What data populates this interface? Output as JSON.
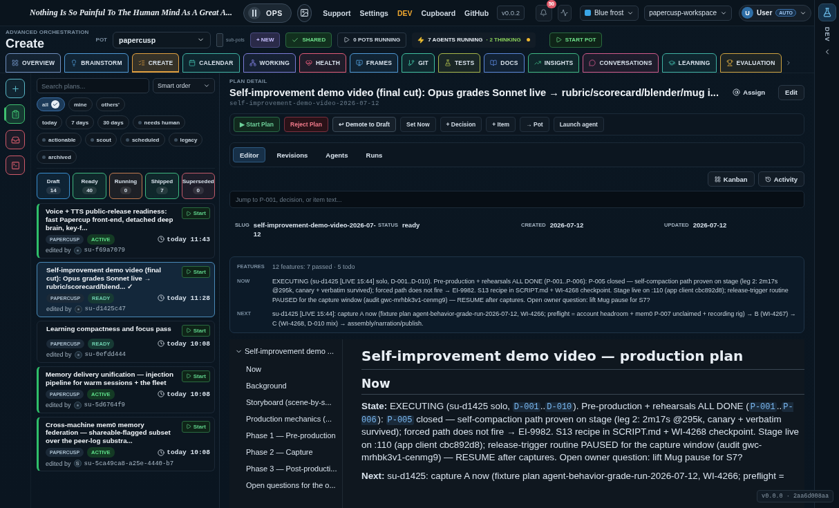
{
  "top_bar": {
    "quote": "Nothing Is So Painful To The Human Mind As A Great A...",
    "ops_label": "OPS",
    "nav": [
      {
        "label": "Support",
        "selected": false
      },
      {
        "label": "Settings",
        "selected": false
      },
      {
        "label": "DEV",
        "selected": true
      },
      {
        "label": "Cupboard",
        "selected": false
      },
      {
        "label": "GitHub",
        "selected": false
      }
    ],
    "version": "v0.0.2",
    "notifications": "50",
    "theme": {
      "label": "Blue frost",
      "color": "#3aa6e8"
    },
    "workspace": "papercusp-workspace",
    "user": {
      "avatar": "U",
      "name": "User",
      "badge": "AUTO"
    }
  },
  "header": {
    "eyebrow": "ADVANCED ORCHESTRATION",
    "title": "Create",
    "pot_label": "POT",
    "pot": "papercusp",
    "subpots": {
      "label": "sub-pots",
      "checked": false
    },
    "buttons": [
      {
        "label": "+ NEW",
        "kind": "new"
      },
      {
        "label": "SHARED",
        "kind": "shared"
      },
      {
        "label": "0 POTS RUNNING",
        "kind": "running"
      }
    ],
    "agents": {
      "label": "7 AGENTS RUNNING",
      "thinking": "· 2 THINKING"
    },
    "start": "START POT"
  },
  "tabs": [
    {
      "label": "OVERVIEW",
      "selected": false,
      "color": "#6f90c0"
    },
    {
      "label": "BRAINSTORM",
      "selected": false,
      "color": "#4f9ad6"
    },
    {
      "label": "CREATE",
      "selected": true,
      "color": "#e0a040"
    },
    {
      "label": "CALENDAR",
      "selected": false,
      "color": "#3fb2a4"
    },
    {
      "label": "WORKING",
      "selected": false,
      "color": "#7c7cd8"
    },
    {
      "label": "HEALTH",
      "selected": false,
      "color": "#e05a78"
    },
    {
      "label": "FRAMES",
      "selected": false,
      "color": "#4f9ad6"
    },
    {
      "label": "GIT",
      "selected": false,
      "color": "#3fc0a0"
    },
    {
      "label": "TESTS",
      "selected": false,
      "color": "#a8b84a"
    },
    {
      "label": "DOCS",
      "selected": false,
      "color": "#5a86d8"
    },
    {
      "label": "INSIGHTS",
      "selected": false,
      "color": "#3fb884"
    },
    {
      "label": "CONVERSATIONS",
      "selected": false,
      "color": "#d05a8c"
    },
    {
      "label": "LEARNING",
      "selected": false,
      "color": "#3fb2a4"
    },
    {
      "label": "EVALUATION",
      "selected": false,
      "color": "#d0a440"
    }
  ],
  "rail": [
    {
      "selected": false,
      "color": "#5ab8c8"
    },
    {
      "selected": true,
      "color": "#3fc070"
    },
    {
      "selected": false,
      "color": "#d05a6a"
    },
    {
      "selected": false,
      "color": "#d05a6a"
    }
  ],
  "plans": {
    "search_placeholder": "Search plans...",
    "order": "Smart order",
    "owner_filters": [
      {
        "label": "all",
        "selected": true
      },
      {
        "label": "mine",
        "selected": false
      },
      {
        "label": "others'",
        "selected": false
      }
    ],
    "filters": [
      {
        "label": "today",
        "kind": "plain"
      },
      {
        "label": "7 days",
        "kind": "plain"
      },
      {
        "label": "30 days",
        "kind": "plain"
      },
      {
        "label": "needs human",
        "kind": "dot"
      },
      {
        "label": "actionable",
        "kind": "dot"
      },
      {
        "label": "scout",
        "kind": "dot"
      },
      {
        "label": "scheduled",
        "kind": "dot"
      },
      {
        "label": "legacy",
        "kind": "dot"
      },
      {
        "label": "archived",
        "kind": "dot"
      }
    ],
    "counts": [
      {
        "label": "Draft",
        "count": "14",
        "color": "#3a8fd0"
      },
      {
        "label": "Ready",
        "count": "40",
        "color": "#3fb880"
      },
      {
        "label": "Running",
        "count": "0",
        "color": "#c07a50"
      },
      {
        "label": "Shipped",
        "count": "7",
        "color": "#3fb880"
      },
      {
        "label": "Superseded",
        "count": "0",
        "color": "#c05a6a"
      }
    ],
    "cards": [
      {
        "title": "Voice + TTS public-release readiness: fast Papercup front-end, detached deep brain, key-f...",
        "pot": "PAPERCUSP",
        "status": "ACTIVE",
        "kind": "active",
        "time": "today 11:43",
        "edited_by": "edited by",
        "editor": "su-f69a7079",
        "selected": false,
        "start": "Start"
      },
      {
        "title": "Self-improvement demo video (final cut): Opus grades Sonnet live → rubric/scorecard/blend... ✓",
        "pot": "PAPERCUSP",
        "status": "READY",
        "kind": "ready",
        "time": "today 11:28",
        "edited_by": "edited by",
        "editor": "su-d1425c47",
        "selected": true,
        "start": "Start"
      },
      {
        "title": "Learning compactness and focus pass",
        "pot": "PAPERCUSP",
        "status": "READY",
        "kind": "ready",
        "time": "today 10:08",
        "edited_by": "edited by",
        "editor": "su-0efdd444",
        "selected": false,
        "start": "Start"
      },
      {
        "title": "Memory delivery unification — injection pipeline for warm sessions + the fleet",
        "pot": "PAPERCUSP",
        "status": "ACTIVE",
        "kind": "active",
        "time": "today 10:08",
        "edited_by": "edited by",
        "editor": "su-5d6764f9",
        "selected": false,
        "start": "Start"
      },
      {
        "title": "Cross-machine mem0 memory federation — shareable-flagged subset over the peer-log substra...",
        "pot": "PAPERCUSP",
        "status": "ACTIVE",
        "kind": "active",
        "time": "today 10:08",
        "edited_by": "edited by",
        "editor": "su-5ca49ca8-a25e-4440-b7",
        "avatar": "S",
        "selected": false,
        "start": "Start"
      }
    ]
  },
  "detail": {
    "eyebrow": "PLAN DETAIL",
    "title": "Self-improvement demo video (final cut): Opus grades Sonnet live → rubric/scorecard/blender/mug i...",
    "slug": "self-improvement-demo-video-2026-07-12",
    "assign": "Assign",
    "edit": "Edit",
    "actions": [
      {
        "label": "▶ Start Plan",
        "kind": "go"
      },
      {
        "label": "Reject Plan",
        "kind": "danger"
      },
      {
        "label": "↩ Demote to Draft",
        "kind": "strong"
      },
      {
        "label": "Set Now",
        "kind": "plain"
      },
      {
        "label": "+ Decision",
        "kind": "plain"
      },
      {
        "label": "+ Item",
        "kind": "plain"
      },
      {
        "label": "→ Pot",
        "kind": "plain"
      },
      {
        "label": "Launch agent",
        "kind": "plain"
      }
    ],
    "tabs": [
      {
        "label": "Editor",
        "selected": true
      },
      {
        "label": "Revisions",
        "selected": false
      },
      {
        "label": "Agents",
        "selected": false
      },
      {
        "label": "Runs",
        "selected": false
      }
    ],
    "views": [
      "Kanban",
      "Activity"
    ],
    "jump_placeholder": "Jump to P-001, decision, or item text...",
    "meta": [
      {
        "label": "SLUG",
        "value": "self-improvement-demo-video-2026-07-12"
      },
      {
        "label": "STATUS",
        "value": "ready"
      },
      {
        "label": "CREATED",
        "value": "2026-07-12"
      },
      {
        "label": "UPDATED",
        "value": "2026-07-12"
      }
    ],
    "summary": [
      {
        "label": "FEATURES",
        "text": "12 features: 7 passed · 5 todo",
        "kind": "muted"
      },
      {
        "label": "NOW",
        "text": "EXECUTING (su-d1425 [LIVE 15:44] solo, D-001..D-010). Pre-production + rehearsals ALL DONE (P-001..P-006): P-005 closed — self-compaction path proven on stage (leg 2: 2m17s @295k, canary + verbatim survived); forced path does not fire → EI-9982. S13 recipe in SCRIPT.md + WI-4268 checkpoint. Stage live on :110 (app client cbc892d8); release-trigger routine PAUSED for the capture window (audit gwc-mrhbk3v1-cenmg9) — RESUME after captures. Open owner question: lift Mug pause for S7?",
        "kind": "body"
      },
      {
        "label": "NEXT",
        "text": "su-d1425 [LIVE 15:44]: capture A now (fixture plan agent-behavior-grade-run-2026-07-12, WI-4266; preflight = account headroom + mem0 P-007 unclaimed + recording rig) → B (WI-4267) → C (WI-4268, D-010 mix) → assembly/narration/publish.",
        "kind": "body"
      }
    ],
    "outline": {
      "label": "Self-improvement demo ...",
      "expanded": true,
      "children": [
        {
          "label": "Now"
        },
        {
          "label": "Background"
        },
        {
          "label": "Storyboard (scene-by-s..."
        },
        {
          "label": "Production mechanics (..."
        },
        {
          "label": "Phase 1 — Pre-production"
        },
        {
          "label": "Phase 2 — Capture"
        },
        {
          "label": "Phase 3 — Post-producti..."
        },
        {
          "label": "Open questions for the o..."
        }
      ]
    },
    "doc": {
      "h1": "Self-improvement demo video — production plan",
      "h2": "Now",
      "paragraphs": [
        [
          {
            "kind": "bold",
            "text": "State:"
          },
          {
            "kind": "text",
            "text": " EXECUTING (su-d1425 solo, "
          },
          {
            "kind": "code",
            "text": "D-001"
          },
          {
            "kind": "text",
            "text": ".."
          },
          {
            "kind": "code",
            "text": "D-010"
          },
          {
            "kind": "text",
            "text": "). Pre-production + rehearsals ALL DONE ("
          },
          {
            "kind": "code",
            "text": "P-001"
          },
          {
            "kind": "text",
            "text": ".."
          },
          {
            "kind": "code",
            "text": "P-006"
          },
          {
            "kind": "text",
            "text": "): "
          },
          {
            "kind": "code",
            "text": "P-005"
          },
          {
            "kind": "text",
            "text": " closed — self-compaction path proven on stage (leg 2: 2m17s @295k, canary + verbatim survived); forced path does not fire → EI-9982. S13 recipe in SCRIPT.md + WI-4268 checkpoint. Stage live on :110 (app client cbc892d8); release-trigger routine PAUSED for the capture window (audit gwc-mrhbk3v1-cenmg9) — RESUME after captures. Open owner question: lift Mug pause for S7?"
          }
        ],
        [
          {
            "kind": "bold",
            "text": "Next:"
          },
          {
            "kind": "text",
            "text": " su-d1425: capture A now (fixture plan agent-behavior-grade-run-2026-07-12, WI-4266; preflight ="
          }
        ]
      ]
    }
  },
  "build": "v0.0.0 · 2aa6d008aa",
  "side_strip": {
    "label": "DEV"
  }
}
